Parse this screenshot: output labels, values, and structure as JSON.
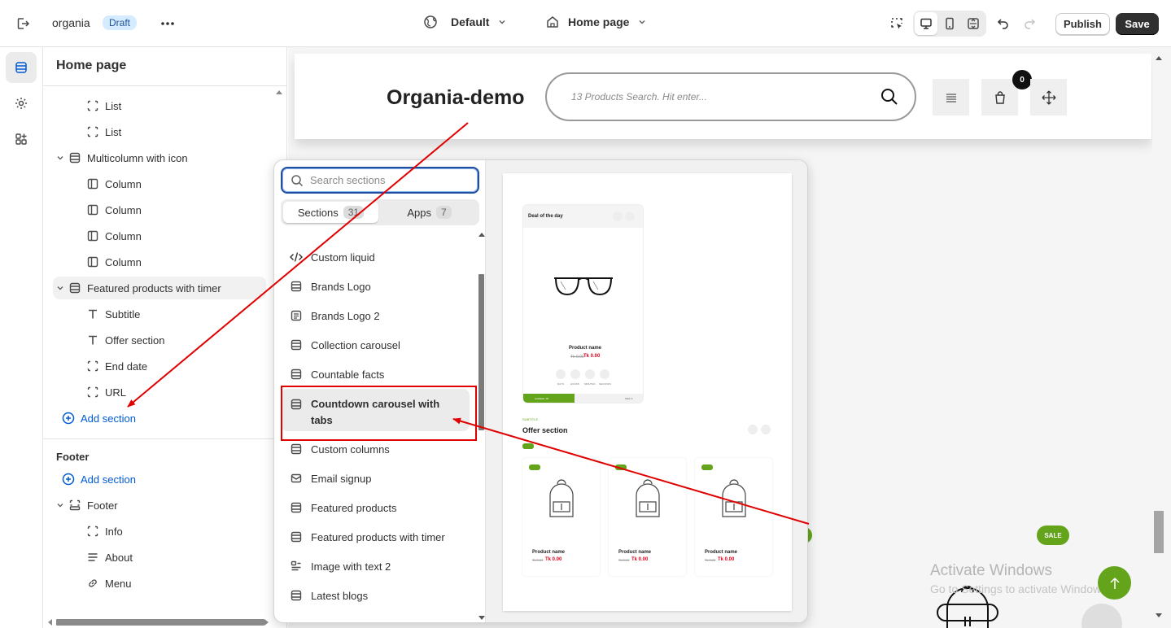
{
  "topbar": {
    "store_name": "organia",
    "status_badge": "Draft",
    "theme_selector": "Default",
    "page_selector": "Home page",
    "publish_label": "Publish",
    "save_label": "Save"
  },
  "sidebar": {
    "title": "Home page",
    "tree": [
      {
        "label": "List",
        "icon": "block-icon",
        "indent": 2
      },
      {
        "label": "List",
        "icon": "block-icon",
        "indent": 2
      },
      {
        "label": "Multicolumn with icon",
        "icon": "section-icon",
        "indent": 1,
        "expanded": true
      },
      {
        "label": "Column",
        "icon": "column-icon",
        "indent": 2
      },
      {
        "label": "Column",
        "icon": "column-icon",
        "indent": 2
      },
      {
        "label": "Column",
        "icon": "column-icon",
        "indent": 2
      },
      {
        "label": "Column",
        "icon": "column-icon",
        "indent": 2
      },
      {
        "label": "Featured products with timer",
        "icon": "section-icon",
        "indent": 1,
        "expanded": true,
        "highlighted": true
      },
      {
        "label": "Subtitle",
        "icon": "text-icon",
        "indent": 2
      },
      {
        "label": "Offer section",
        "icon": "text-icon",
        "indent": 2
      },
      {
        "label": "End date",
        "icon": "block-icon",
        "indent": 2
      },
      {
        "label": "URL",
        "icon": "block-icon",
        "indent": 2
      }
    ],
    "add_section_label": "Add section",
    "footer_heading": "Footer",
    "footer_add_section_label": "Add section",
    "footer_tree": [
      {
        "label": "Footer",
        "icon": "footer-icon",
        "indent": 1,
        "expanded": true
      },
      {
        "label": "Info",
        "icon": "block-icon",
        "indent": 2
      },
      {
        "label": "About",
        "icon": "lines-icon",
        "indent": 2
      },
      {
        "label": "Menu",
        "icon": "link-icon",
        "indent": 2
      }
    ]
  },
  "picker": {
    "search_placeholder": "Search sections",
    "tabs": [
      {
        "label": "Sections",
        "count": "31",
        "active": true
      },
      {
        "label": "Apps",
        "count": "7",
        "active": false
      }
    ],
    "items": [
      {
        "label": "Custom liquid",
        "icon": "code-icon"
      },
      {
        "label": "Brands Logo",
        "icon": "section-icon"
      },
      {
        "label": "Brands Logo 2",
        "icon": "document-icon"
      },
      {
        "label": "Collection carousel",
        "icon": "section-icon"
      },
      {
        "label": "Countable facts",
        "icon": "section-icon"
      },
      {
        "label": "Countdown carousel with tabs",
        "icon": "section-icon",
        "selected": true
      },
      {
        "label": "Custom columns",
        "icon": "section-icon"
      },
      {
        "label": "Email signup",
        "icon": "email-icon"
      },
      {
        "label": "Featured products",
        "icon": "section-icon"
      },
      {
        "label": "Featured products with timer",
        "icon": "section-icon"
      },
      {
        "label": "Image with text 2",
        "icon": "image-text-icon"
      },
      {
        "label": "Latest blogs",
        "icon": "section-icon"
      }
    ],
    "preview": {
      "deal_title": "Deal of the day",
      "product_name": "Product name",
      "old_price": "Tk 0.00",
      "new_price": "Tk 0.00",
      "timer_labels": [
        "DAYS",
        "HOURS",
        "MINUTES",
        "SECONDS"
      ],
      "available_label": "Available: 00",
      "sold_label": "Sold: 0",
      "subtitle": "SUBTITLE",
      "offer_title": "Offer section"
    }
  },
  "site": {
    "logo": "Organia-demo",
    "search_placeholder": "13 Products Search. Hit enter...",
    "cart_count": "0",
    "sale_label": "SALE",
    "watermark_title": "Activate Windows",
    "watermark_sub": "Go to Settings to activate Windows."
  },
  "colors": {
    "accent_blue": "#005bd3",
    "annotation_red": "#e00000",
    "brand_green": "#63a41b",
    "save_dark": "#303030"
  }
}
